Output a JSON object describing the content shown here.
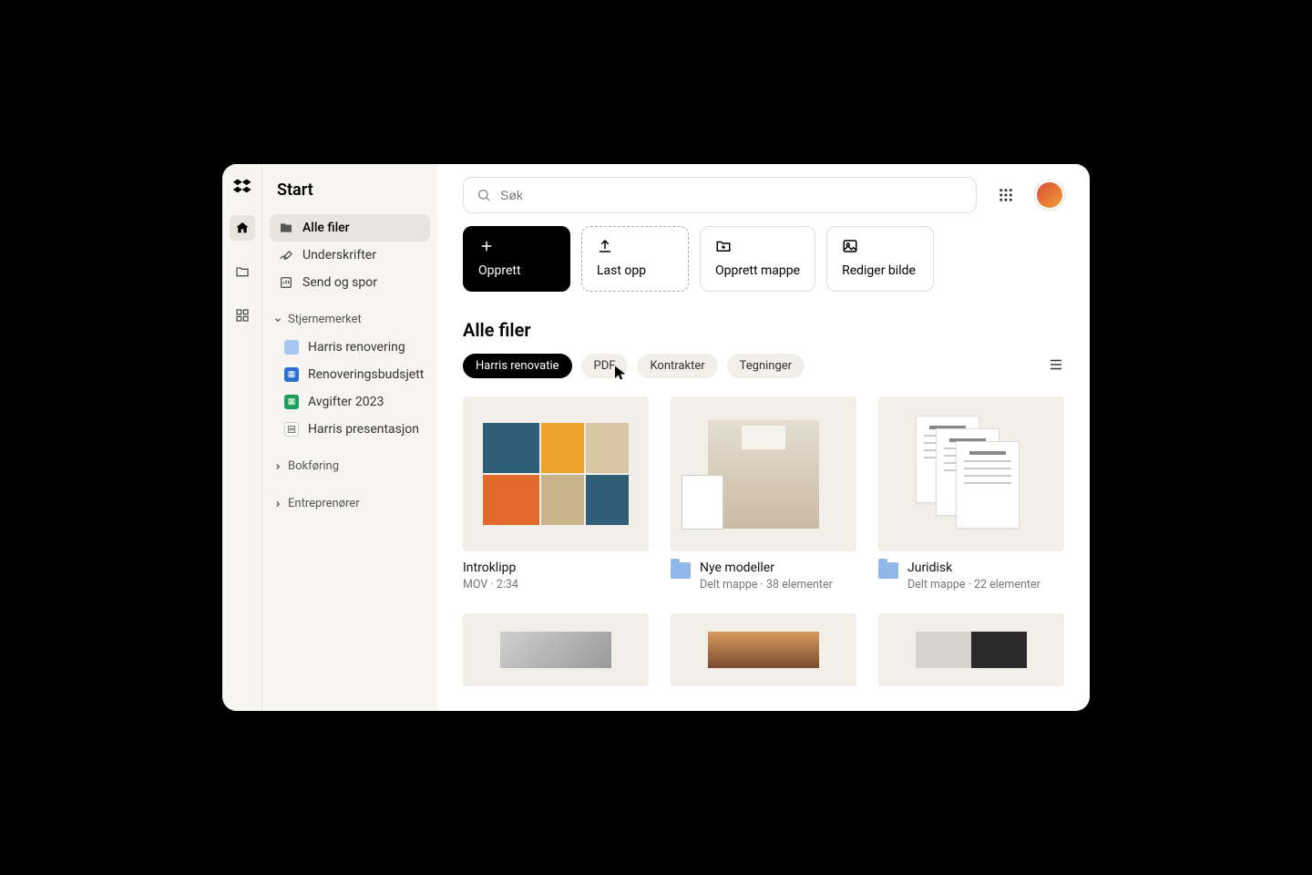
{
  "sidebar": {
    "title": "Start",
    "nav": [
      {
        "label": "Alle filer",
        "icon": "folder-icon",
        "active": true
      },
      {
        "label": "Underskrifter",
        "icon": "signature-icon",
        "active": false
      },
      {
        "label": "Send og spor",
        "icon": "tracking-icon",
        "active": false
      }
    ],
    "starred_header": "Stjernemerket",
    "starred": [
      {
        "label": "Harris renovering",
        "kind": "folder"
      },
      {
        "label": "Renoveringsbudsjett",
        "kind": "sheet-blue"
      },
      {
        "label": "Avgifter 2023",
        "kind": "sheet-green"
      },
      {
        "label": "Harris presentasjon",
        "kind": "pres"
      }
    ],
    "sections": [
      {
        "label": "Bokføring"
      },
      {
        "label": "Entreprenører"
      }
    ]
  },
  "search": {
    "placeholder": "Søk"
  },
  "actions": [
    {
      "label": "Opprett",
      "icon": "plus-icon",
      "variant": "primary"
    },
    {
      "label": "Last opp",
      "icon": "upload-icon",
      "variant": "dashed"
    },
    {
      "label": "Opprett mappe",
      "icon": "new-folder-icon",
      "variant": "outline"
    },
    {
      "label": "Rediger bilde",
      "icon": "image-icon",
      "variant": "outline"
    }
  ],
  "main": {
    "heading": "Alle filer",
    "chips": [
      {
        "label": "Harris renovatie",
        "active": true
      },
      {
        "label": "PDF",
        "active": false
      },
      {
        "label": "Kontrakter",
        "active": false
      },
      {
        "label": "Tegninger",
        "active": false
      }
    ],
    "items": [
      {
        "title": "Introklipp",
        "sub": "MOV · 2:34",
        "thumb": "mosaic",
        "folder": false
      },
      {
        "title": "Nye modeller",
        "sub": "Delt mappe · 38 elementer",
        "thumb": "room",
        "folder": true
      },
      {
        "title": "Juridisk",
        "sub": "Delt mappe · 22 elementer",
        "thumb": "docs",
        "folder": true
      },
      {
        "title": "",
        "sub": "",
        "thumb": "concrete",
        "folder": false
      },
      {
        "title": "",
        "sub": "",
        "thumb": "warm",
        "folder": false
      },
      {
        "title": "",
        "sub": "",
        "thumb": "gray-dual",
        "folder": false
      }
    ]
  }
}
